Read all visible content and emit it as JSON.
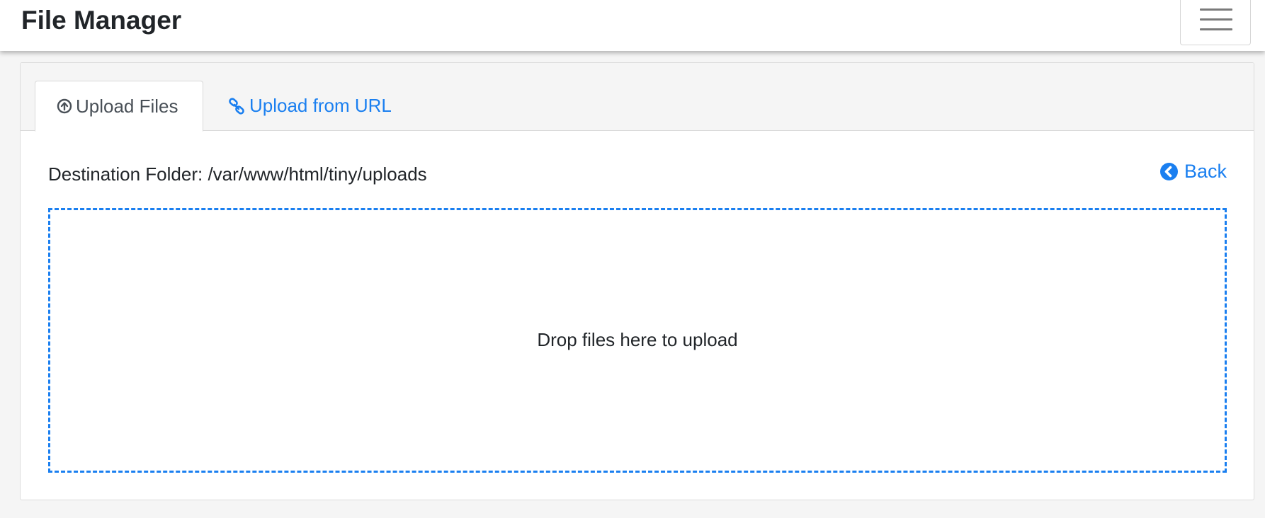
{
  "navbar": {
    "brand": "File Manager",
    "toggle_icon": "hamburger-menu-icon"
  },
  "tabs": [
    {
      "label": "Upload Files",
      "icon": "upload-circle-icon",
      "active": true
    },
    {
      "label": "Upload from URL",
      "icon": "link-icon",
      "active": false
    }
  ],
  "upload": {
    "destination_label": "Destination Folder: /var/www/html/tiny/uploads",
    "back_label": "Back",
    "back_icon": "chevron-left-circle-icon",
    "dropzone_message": "Drop files here to upload"
  },
  "colors": {
    "accent": "#1a7ff0",
    "text": "#212529",
    "background": "#f5f5f5"
  }
}
